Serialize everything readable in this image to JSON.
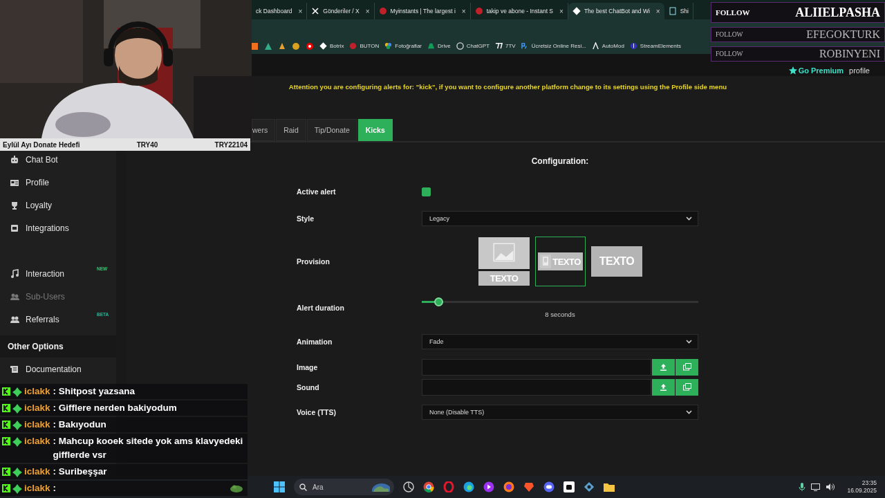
{
  "browser": {
    "tabs": [
      {
        "title": "ck Dashboard",
        "selected": false,
        "close": "×"
      },
      {
        "title": "Gönderiler / X",
        "selected": false,
        "close": "×"
      },
      {
        "title": "Myinstants | The largest i",
        "selected": false,
        "close": "×"
      },
      {
        "title": "takip ve abone - Instant S",
        "selected": false,
        "close": "×"
      },
      {
        "title": "The best ChatBot and Wi",
        "selected": true,
        "close": "×"
      },
      {
        "title": "Shi",
        "selected": false
      }
    ],
    "bookmarks": [
      {
        "label": "Botrix"
      },
      {
        "label": "BUTON"
      },
      {
        "label": "Fotoğraflar"
      },
      {
        "label": "Drive"
      },
      {
        "label": "ChatGPT"
      },
      {
        "label": "7TV"
      },
      {
        "label": "Ücretsiz Online Resi..."
      },
      {
        "label": "AutoMod"
      },
      {
        "label": "StreamElements"
      }
    ]
  },
  "header": {
    "premium": "Go Premium",
    "profile": "profile"
  },
  "notice": "Attention you are configuring alerts for: \"kick\", if you want to configure another platform change to its settings using the Profile side menu",
  "sidebar": {
    "items": [
      {
        "label": "Chat Bot",
        "disabled": false
      },
      {
        "label": "Profile",
        "disabled": false
      },
      {
        "label": "Loyalty",
        "disabled": false
      },
      {
        "label": "Integrations",
        "disabled": false
      },
      {
        "label": "Interaction",
        "disabled": false,
        "badge": "NEW",
        "color": "#2ecc71"
      },
      {
        "label": "Sub-Users",
        "disabled": true
      },
      {
        "label": "Referrals",
        "disabled": false,
        "badge": "BETA",
        "color": "#1abc9c"
      }
    ],
    "section": "Other Options",
    "section_items": [
      {
        "label": "Documentation"
      }
    ]
  },
  "alert_tabs": [
    {
      "label": "wers",
      "selected": false
    },
    {
      "label": "Raid",
      "selected": false
    },
    {
      "label": "Tip/Donate",
      "selected": false
    },
    {
      "label": "Kicks",
      "selected": true
    }
  ],
  "config": {
    "title": "Configuration:",
    "fields": [
      {
        "kind": "checkbox",
        "label": "Active alert",
        "checked": true
      },
      {
        "kind": "select",
        "label": "Style",
        "value": "Legacy"
      },
      {
        "kind": "provision",
        "label": "Provision",
        "options": [
          {
            "kind": "stacked",
            "text": "TEXTO",
            "selected": false
          },
          {
            "kind": "side",
            "text": "TEXTO",
            "selected": true
          },
          {
            "kind": "overlay",
            "text": "TEXTO",
            "selected": false
          }
        ]
      },
      {
        "kind": "slider",
        "label": "Alert duration",
        "level": 0.06,
        "reading": "8 seconds"
      },
      {
        "kind": "select",
        "label": "Animation",
        "value": "Fade"
      },
      {
        "kind": "file",
        "label": "Image"
      },
      {
        "kind": "file",
        "label": "Sound"
      },
      {
        "kind": "select",
        "label": "Voice (TTS)",
        "value": "None (Disable TTS)"
      }
    ]
  },
  "taskbar": {
    "search_placeholder": "Ara",
    "time": "23:35",
    "date": "16.09.2025"
  },
  "overlay": {
    "donate_goal": {
      "label": "Eylül Ayı Donate Hedefi",
      "current": "TRY40",
      "target": "TRY22104"
    },
    "follows": [
      {
        "label": "FOLLOW",
        "name": "ALIIELPASHA"
      },
      {
        "label": "FOLLOW",
        "name": "EFEGOKTURK"
      },
      {
        "label": "FOLLOW",
        "name": "ROBINYENI"
      }
    ],
    "chat": [
      {
        "user": "iclakk",
        "text": ": Shitpost yazsana"
      },
      {
        "user": "iclakk",
        "text": ": Gifflere nerden bakiyodum"
      },
      {
        "user": "iclakk",
        "text": ": Bakıyodun"
      },
      {
        "user": "iclakk",
        "text": ": Mahcup kooek sitede yok ams klavyedeki gifflerde vsr"
      },
      {
        "user": "iclakk",
        "text": ": Suribeşşar"
      },
      {
        "user": "iclakk",
        "text": ":",
        "kind": "emote"
      }
    ]
  }
}
